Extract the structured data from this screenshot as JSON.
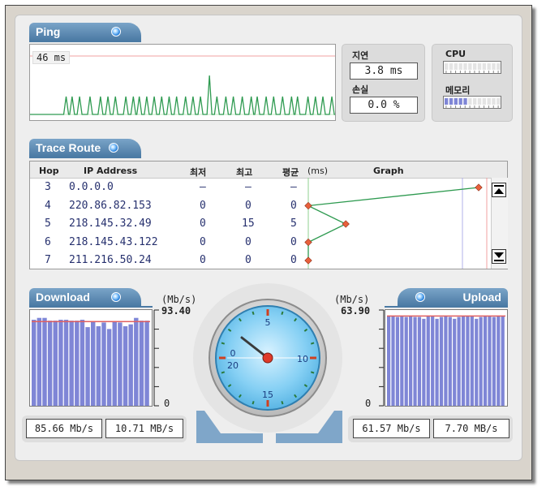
{
  "ping": {
    "title": "Ping",
    "current": "46 ms",
    "spikes": [
      6,
      10,
      14,
      20,
      24,
      34,
      38,
      44,
      52,
      56,
      62,
      68,
      72,
      82,
      86,
      90,
      96,
      100,
      104,
      110,
      114,
      120,
      124,
      128,
      134,
      138,
      144,
      150,
      154,
      158,
      166,
      172,
      176,
      182,
      186,
      194,
      198,
      204,
      208,
      212,
      220,
      226,
      230,
      236,
      242,
      248,
      254,
      258,
      262,
      268,
      274,
      280,
      284,
      290,
      296,
      302,
      308,
      312,
      316,
      322,
      330,
      334,
      340,
      344,
      350,
      356,
      362
    ],
    "tall_spike_index": 37
  },
  "latency": {
    "label": "지연",
    "value": "3.8 ms"
  },
  "loss": {
    "label": "손실",
    "value": "0.0 %"
  },
  "cpu": {
    "label": "CPU",
    "level": 0
  },
  "memory": {
    "label": "메모리",
    "level": 0.45
  },
  "trace": {
    "title": "Trace Route",
    "headers": {
      "hop": "Hop",
      "ip": "IP Address",
      "min": "최저",
      "max": "최고",
      "avg": "평균",
      "unit": "(ms)",
      "graph": "Graph"
    },
    "rows": [
      {
        "hop": "3",
        "ip": "0.0.0.0",
        "min": "–",
        "max": "–",
        "avg": "–"
      },
      {
        "hop": "4",
        "ip": "220.86.82.153",
        "min": "0",
        "max": "0",
        "avg": "0"
      },
      {
        "hop": "5",
        "ip": "218.145.32.49",
        "min": "0",
        "max": "15",
        "avg": "5"
      },
      {
        "hop": "6",
        "ip": "218.145.43.122",
        "min": "0",
        "max": "0",
        "avg": "0"
      },
      {
        "hop": "7",
        "ip": "211.216.50.24",
        "min": "0",
        "max": "0",
        "avg": "0"
      }
    ],
    "graph_points": [
      1.0,
      0.0,
      0.22,
      0.0,
      0.0
    ]
  },
  "download": {
    "title": "Download",
    "unit": "(Mb/s)",
    "max": "93.40",
    "min": "0",
    "rate_mbps": "85.66 Mb/s",
    "rate_MBps": "10.71 MB/s",
    "bars": [
      0.93,
      0.95,
      0.95,
      0.92,
      0.92,
      0.93,
      0.93,
      0.92,
      0.92,
      0.93,
      0.85,
      0.91,
      0.86,
      0.9,
      0.83,
      0.91,
      0.9,
      0.86,
      0.88,
      0.95,
      0.92,
      0.92
    ],
    "avg": 0.91
  },
  "upload": {
    "title": "Upload",
    "unit": "(Mb/s)",
    "max": "63.90",
    "min": "0",
    "rate_mbps": "61.57 Mb/s",
    "rate_MBps": "7.70 MB/s",
    "bars": [
      0.97,
      0.97,
      0.96,
      0.97,
      0.96,
      0.97,
      0.96,
      0.96,
      0.94,
      0.97,
      0.97,
      0.94,
      0.96,
      0.97,
      0.96,
      0.94,
      0.96,
      0.97,
      0.97,
      0.97,
      0.94,
      0.96,
      0.97,
      0.97,
      0.96,
      0.97,
      0.97
    ],
    "avg": 0.97
  },
  "gauge": {
    "labels": {
      "n0": "0",
      "n5": "5",
      "n10": "10",
      "n15": "15",
      "n20": "20"
    },
    "needle_value": 0.5
  },
  "colors": {
    "accent": "#4b7aa4",
    "bar": "#7f86d6",
    "avg_line": "#e06060",
    "ping_line": "#2e9a50"
  }
}
